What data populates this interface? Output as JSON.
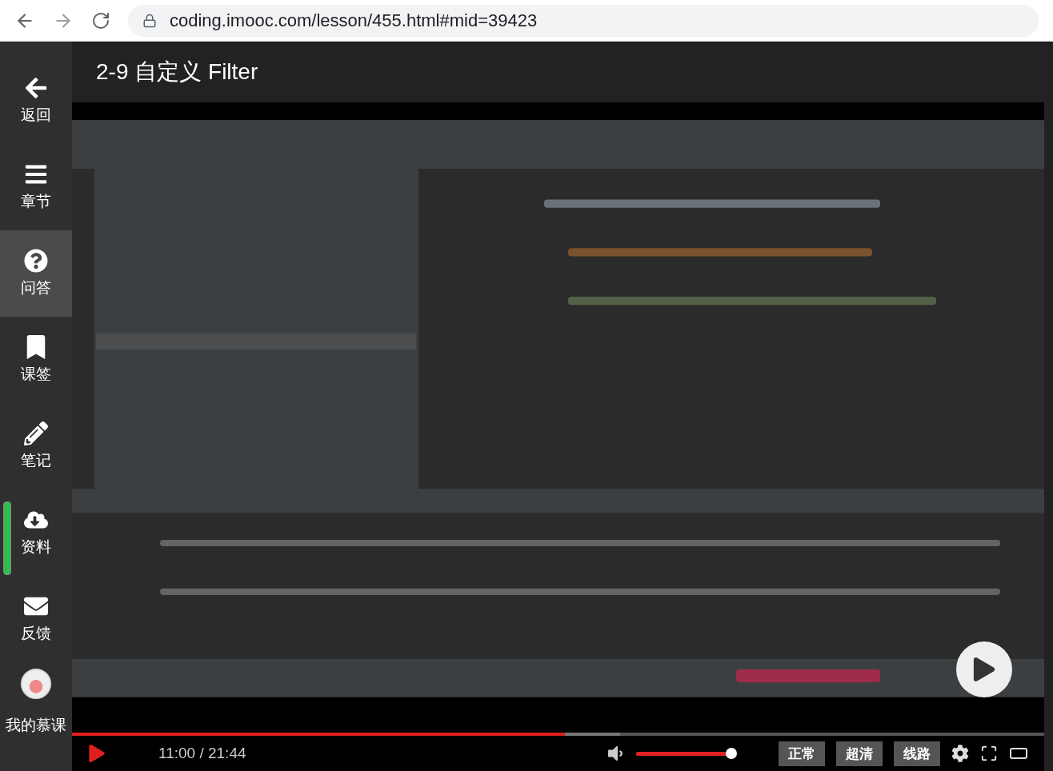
{
  "browser": {
    "url": "coding.imooc.com/lesson/455.html#mid=39423"
  },
  "sidebar": {
    "items": [
      {
        "kind": "back",
        "label": "返回",
        "selected": false
      },
      {
        "kind": "chapters",
        "label": "章节",
        "selected": false
      },
      {
        "kind": "questions",
        "label": "问答",
        "selected": true
      },
      {
        "kind": "bookmarks",
        "label": "课签",
        "selected": false
      },
      {
        "kind": "notes",
        "label": "笔记",
        "selected": false
      },
      {
        "kind": "materials",
        "label": "资料",
        "selected": false
      },
      {
        "kind": "feedback",
        "label": "反馈",
        "selected": false
      }
    ],
    "profile": {
      "label": "我的慕课"
    }
  },
  "lesson": {
    "title": "2-9 自定义 Filter"
  },
  "video": {
    "kind": "picture",
    "progress": {
      "level": 0.507
    },
    "buffered": {
      "level": 0.564
    },
    "time": "11:00 / 21:44",
    "volume": {
      "level": 0.95
    },
    "buttons": [
      "正常",
      "超清",
      "线路"
    ]
  }
}
